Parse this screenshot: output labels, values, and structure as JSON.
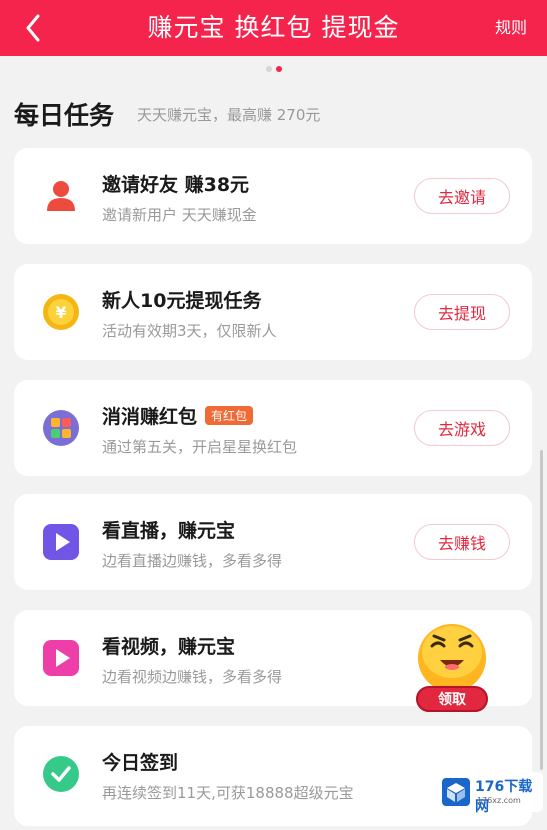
{
  "header": {
    "title": "赚元宝 换红包 提现金",
    "rules": "规则"
  },
  "section": {
    "title": "每日任务",
    "subtitle": "天天赚元宝，最高赚 270元"
  },
  "tasks": [
    {
      "title": "邀请好友 赚38元",
      "desc": "邀请新用户 天天赚现金",
      "button": "去邀请",
      "icon": "user-icon"
    },
    {
      "title": "新人10元提现任务",
      "desc": "活动有效期3天，仅限新人",
      "button": "去提现",
      "icon": "yuan-coin-icon"
    },
    {
      "title": "消消赚红包",
      "badge": "有红包",
      "desc": "通过第五关，开启星星换红包",
      "button": "去游戏",
      "icon": "game-icon"
    },
    {
      "title": "看直播，赚元宝",
      "desc": "边看直播边赚钱，多看多得",
      "button": "去赚钱",
      "icon": "live-play-icon"
    },
    {
      "title": "看视频，赚元宝",
      "desc": "边看视频边赚钱，多看多得",
      "button": "",
      "icon": "video-play-icon"
    },
    {
      "title": "今日签到",
      "desc": "再连续签到11天,可获18888超级元宝",
      "button": "",
      "icon": "checkmark-icon"
    }
  ],
  "floating": {
    "claim": "领取"
  },
  "watermark": {
    "text": "176下载网",
    "sub": "176xz.com"
  },
  "colors": {
    "brand": "#f4244c",
    "button_text": "#e2283f"
  }
}
